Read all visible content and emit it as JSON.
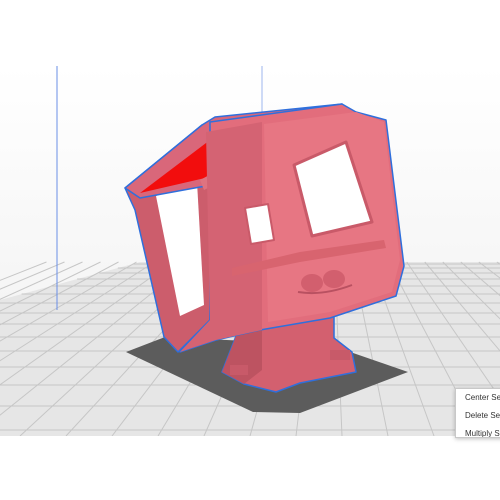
{
  "app": {
    "name": "",
    "view": "3d-prepare-viewport"
  },
  "colors": {
    "model_fill": "#e26d7c",
    "model_shade": "#c95a69",
    "model_highlight": "#ee8a97",
    "selection_outline": "#2f6fdc",
    "overhang_red": "#f20d0d",
    "build_plate": "#e4e4e4",
    "grid_line": "#c4c4c4",
    "shadow": "#5a5a5a",
    "axis_line": "#6a8fe6"
  },
  "context_menu": {
    "items": [
      {
        "label": "Center Selected"
      },
      {
        "label": "Delete Selected"
      },
      {
        "label": "Multiply Selected"
      }
    ]
  },
  "model": {
    "icon": "fpv-camera-mount-model",
    "selected": true
  }
}
